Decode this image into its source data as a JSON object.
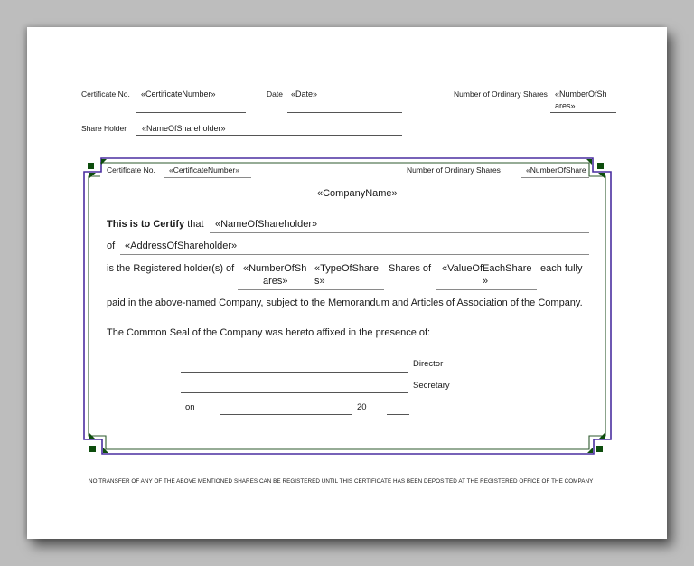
{
  "header": {
    "certificate_no_label": "Certificate No.",
    "certificate_no_value": "«CertificateNumber»",
    "date_label": "Date",
    "date_value": "«Date»",
    "shares_label": "Number of Ordinary Shares",
    "shares_value_line1": "«NumberOfSh",
    "shares_value_line2": "ares»",
    "holder_label": "Share Holder",
    "holder_value": "«NameOfShareholder»"
  },
  "certificate": {
    "certificate_no_label": "Certificate No.",
    "certificate_no_value": "«CertificateNumber»",
    "shares_label": "Number of Ordinary Shares",
    "shares_value": "«NumberOfShare",
    "company_name": "«CompanyName»",
    "certify_bold": "This is to Certify",
    "certify_rest": "that",
    "shareholder_name": "«NameOfShareholder»",
    "of_label": "of",
    "address": "«AddressOfShareholder»",
    "registered_text": "is the Registered holder(s) of",
    "num_shares_line1": "«NumberOfSh",
    "num_shares_line2": "ares»",
    "type_line1": "«TypeOfShare",
    "type_line2": "s»",
    "shares_of": "Shares of",
    "value_line1": "«ValueOfEachShare",
    "value_line2": "»",
    "each_fully": "each fully",
    "paid_text": "paid in the above-named Company, subject to the Memorandum and Articles of Association of the Company.",
    "seal_text": "The Common Seal of the Company was hereto affixed in the presence of:",
    "director_label": "Director",
    "secretary_label": "Secretary",
    "on_label": "on",
    "year_prefix": "20"
  },
  "footer": {
    "notice": "NO TRANSFER OF ANY OF THE ABOVE MENTIONED SHARES CAN BE REGISTERED UNTIL THIS CERTIFICATE HAS BEEN DEPOSITED AT THE REGISTERED OFFICE OF THE COMPANY"
  },
  "colors": {
    "outer_border": "#4a2fa0",
    "inner_border": "#2e5a2e",
    "corner_square": "#0d4d0d",
    "background": "#bdbdbd"
  }
}
